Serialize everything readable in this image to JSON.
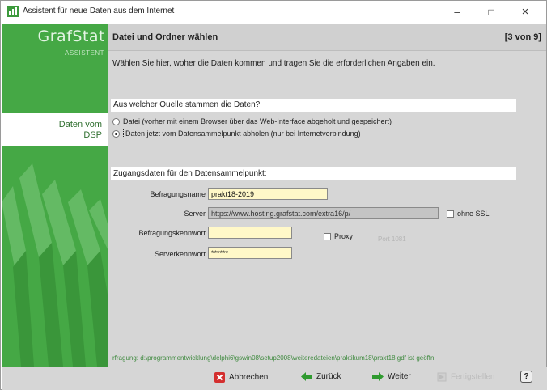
{
  "window": {
    "title": "Assistent für neue Daten aus dem Internet",
    "controls": {
      "minimize": "–",
      "maximize": "□",
      "close": "×"
    }
  },
  "sidebar": {
    "brand": "GrafStat",
    "brand_sub": "ASSISTENT",
    "active_item_line1": "Daten vom",
    "active_item_line2": "DSP"
  },
  "header": {
    "title": "Datei und Ordner wählen",
    "step": "[3 von 9]"
  },
  "intro": "Wählen Sie hier, woher die Daten kommen und tragen Sie die erforderlichen Angaben ein.",
  "source": {
    "heading": "Aus welcher Quelle stammen die Daten?",
    "options": [
      {
        "label": "Datei   (vorher mit einem Browser über das Web-Interface abgeholt und gespeichert)",
        "selected": false
      },
      {
        "label": "Daten jetzt vom Datensammelpunkt abholen   (nur bei Internetverbindung)",
        "selected": true
      }
    ]
  },
  "access": {
    "heading": "Zugangsdaten für den Datensammelpunkt:",
    "survey_name_label": "Befragungsname",
    "survey_name_value": "prakt18-2019",
    "server_label": "Server",
    "server_value": "https://www.hosting.grafstat.com/extra16/p/",
    "ssl_label": "ohne SSL",
    "survey_password_label": "Befragungskennwort",
    "survey_password_value": "",
    "proxy_label": "Proxy",
    "port_label": "Port 1081",
    "server_password_label": "Serverkennwort",
    "server_password_value": "******"
  },
  "status": "rfragung: d:\\programmentwicklung\\delphi6\\gswin08\\setup2008\\weiteredateien\\praktikum18\\prakt18.gdf ist geöffn",
  "footer": {
    "cancel": "Abbrechen",
    "back": "Zurück",
    "next": "Weiter",
    "finish": "Fertigstellen",
    "help": "?"
  }
}
